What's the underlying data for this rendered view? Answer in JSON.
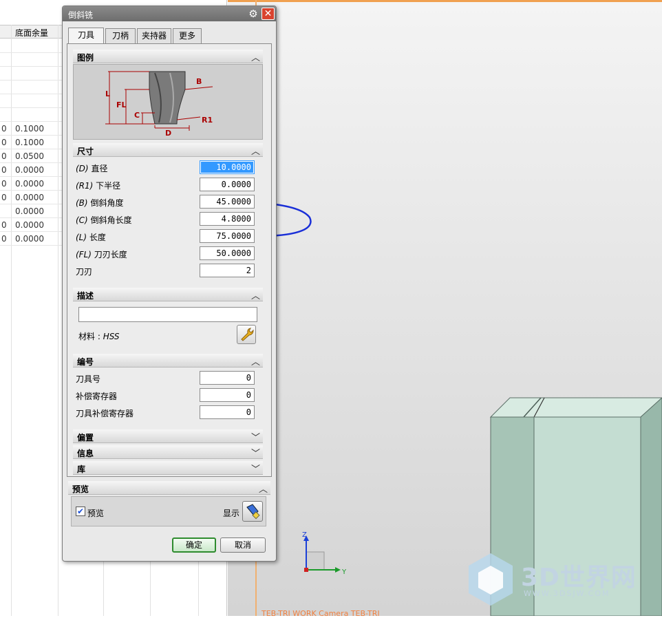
{
  "navigator": {
    "column_header": "底面余量",
    "rows": [
      {
        "left": "",
        "value": ""
      },
      {
        "left": "",
        "value": ""
      },
      {
        "left": "",
        "value": ""
      },
      {
        "left": "",
        "value": ""
      },
      {
        "left": "",
        "value": ""
      },
      {
        "left": "",
        "value": ""
      },
      {
        "left": "0",
        "value": "0.1000"
      },
      {
        "left": "0",
        "value": "0.1000"
      },
      {
        "left": "0",
        "value": "0.0500"
      },
      {
        "left": "0",
        "value": "0.0000"
      },
      {
        "left": "0",
        "value": "0.0000"
      },
      {
        "left": "0",
        "value": "0.0000"
      },
      {
        "left": "",
        "value": "0.0000"
      },
      {
        "left": "0",
        "value": "0.0000"
      },
      {
        "left": "0",
        "value": "0.0000"
      }
    ]
  },
  "dialog": {
    "title": "倒斜铣",
    "tabs": [
      "刀具",
      "刀柄",
      "夹持器",
      "更多"
    ],
    "sections": {
      "legend": "图例",
      "dimensions": "尺寸",
      "description": "描述",
      "numbering": "编号",
      "offset": "偏置",
      "info": "信息",
      "library": "库",
      "preview": "预览"
    },
    "diagram_labels": {
      "L": "L",
      "FL": "FL",
      "C": "C",
      "D": "D",
      "B": "B",
      "R1": "R1"
    },
    "dimension_fields": [
      {
        "prefix": "(D)",
        "label": "直径",
        "value": "10.0000"
      },
      {
        "prefix": "(R1)",
        "label": "下半径",
        "value": "0.0000"
      },
      {
        "prefix": "(B)",
        "label": "倒斜角度",
        "value": "45.0000"
      },
      {
        "prefix": "(C)",
        "label": "倒斜角长度",
        "value": "4.8000"
      },
      {
        "prefix": "(L)",
        "label": "长度",
        "value": "75.0000"
      },
      {
        "prefix": "(FL)",
        "label": "刀刃长度",
        "value": "50.0000"
      },
      {
        "prefix": "",
        "label": "刀刃",
        "value": "2"
      }
    ],
    "description_value": "",
    "material_label": "材料 : ",
    "material_value": "HSS",
    "numbering_fields": [
      {
        "label": "刀具号",
        "value": "0"
      },
      {
        "label": "补偿寄存器",
        "value": "0"
      },
      {
        "label": "刀具补偿寄存器",
        "value": "0"
      }
    ],
    "preview_checkbox_label": "预览",
    "preview_checked": true,
    "display_label": "显示",
    "ok_label": "确定",
    "cancel_label": "取消"
  },
  "viewport": {
    "status_text": "TEB-TRI WORK Camera TEB-TRI",
    "axis_labels": {
      "z": "Z",
      "y": "Y"
    },
    "watermark_text": "3D世界网",
    "watermark_url": "WWW.3DSJW.COM"
  },
  "colors": {
    "accent_selection": "#3399ff",
    "annotation_ink": "#1a2fd8",
    "close_button": "#d9432f",
    "ok_border": "#2e8b2e",
    "model_face": "#b8d4c8"
  }
}
